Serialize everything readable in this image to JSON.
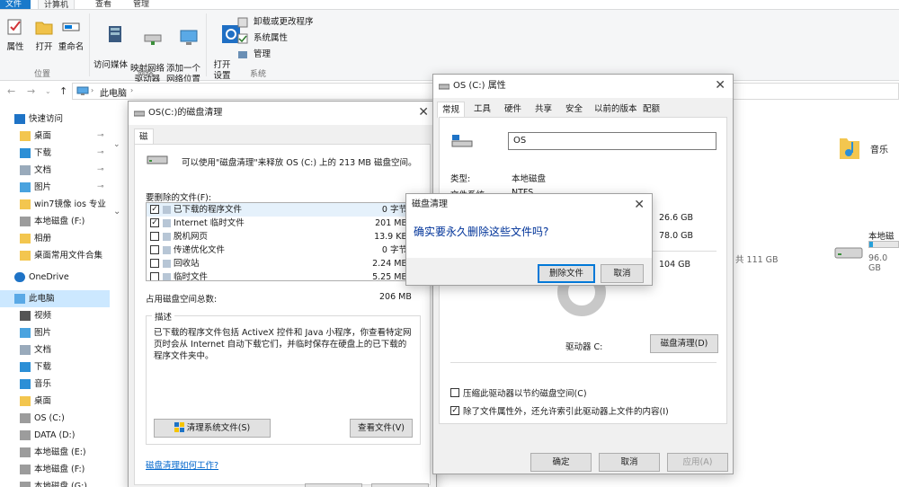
{
  "ribbon": {
    "tabs": [
      "文件",
      "计算机",
      "查看",
      "管理"
    ],
    "location_group": {
      "label": "位置",
      "buttons": [
        "属性",
        "打开",
        "重命名"
      ]
    },
    "network_group": {
      "label": "网络",
      "buttons": [
        "访问媒体",
        "映射网络\n驱动器",
        "添加一个\n网络位置"
      ]
    },
    "system_group": {
      "label": "系统",
      "open_settings": "打开\n设置",
      "small": [
        "卸载或更改程序",
        "系统属性",
        "管理"
      ]
    }
  },
  "address": {
    "path": "此电脑"
  },
  "nav": {
    "items": [
      {
        "label": "快速访问",
        "icon": "star-icon",
        "pinned": false
      },
      {
        "label": "桌面",
        "icon": "folder-icon",
        "pinned": true
      },
      {
        "label": "下载",
        "icon": "download-icon",
        "pinned": true
      },
      {
        "label": "文档",
        "icon": "document-icon",
        "pinned": true
      },
      {
        "label": "图片",
        "icon": "picture-icon",
        "pinned": true
      },
      {
        "label": "win7镜像 ios  专业",
        "icon": "folder-icon",
        "pinned": false
      },
      {
        "label": "本地磁盘 (F:)",
        "icon": "drive-icon",
        "pinned": false
      },
      {
        "label": "相册",
        "icon": "folder-icon",
        "pinned": false
      },
      {
        "label": "桌面常用文件合集",
        "icon": "folder-icon",
        "pinned": false
      },
      {
        "label": "OneDrive",
        "icon": "cloud-icon",
        "pinned": false
      },
      {
        "label": "此电脑",
        "icon": "computer-icon",
        "pinned": false
      },
      {
        "label": "视频",
        "icon": "video-icon",
        "pinned": false
      },
      {
        "label": "图片",
        "icon": "picture-icon",
        "pinned": false
      },
      {
        "label": "文档",
        "icon": "document-icon",
        "pinned": false
      },
      {
        "label": "下载",
        "icon": "download-icon",
        "pinned": false
      },
      {
        "label": "音乐",
        "icon": "music-icon",
        "pinned": false
      },
      {
        "label": "桌面",
        "icon": "folder-icon",
        "pinned": false
      },
      {
        "label": "OS (C:)",
        "icon": "drive-icon",
        "pinned": false
      },
      {
        "label": "DATA (D:)",
        "icon": "drive-icon",
        "pinned": false
      },
      {
        "label": "本地磁盘 (E:)",
        "icon": "drive-icon",
        "pinned": false
      },
      {
        "label": "本地磁盘 (F:)",
        "icon": "drive-icon",
        "pinned": false
      },
      {
        "label": "本地磁盘 (G:)",
        "icon": "drive-icon",
        "pinned": false
      }
    ],
    "selected": "此电脑"
  },
  "content": {
    "music_label": "音乐",
    "drive_free_text": "共 111 GB",
    "drive2_name": "本地磁",
    "drive2_free": "96.0 GB"
  },
  "cleanup": {
    "title": "OS(C:)的磁盘清理",
    "tab": "磁盘清理",
    "intro": "可以使用\"磁盘清理\"来释放 OS (C:) 上的 213 MB 磁盘空间。",
    "files_label": "要删除的文件(F):",
    "files": [
      {
        "name": "已下载的程序文件",
        "size": "0 字节",
        "checked": true
      },
      {
        "name": "Internet 临时文件",
        "size": "201 MB",
        "checked": true
      },
      {
        "name": "脱机网页",
        "size": "13.9 KB",
        "checked": false
      },
      {
        "name": "传递优化文件",
        "size": "0 字节",
        "checked": false
      },
      {
        "name": "回收站",
        "size": "2.24 MB",
        "checked": false
      },
      {
        "name": "临时文件",
        "size": "5.25 MB",
        "checked": false
      }
    ],
    "total_label": "占用磁盘空间总数:",
    "total_value": "206 MB",
    "desc_label": "描述",
    "desc_text": "已下载的程序文件包括 ActiveX 控件和 Java 小程序，你查看特定网页时会从 Internet 自动下载它们，并临时保存在硬盘上的已下载的程序文件夹中。",
    "clean_system_btn": "清理系统文件(S)",
    "view_files_btn": "查看文件(V)",
    "how_link": "磁盘清理如何工作?"
  },
  "props": {
    "title": "OS (C:) 属性",
    "tabs": [
      "常规",
      "工具",
      "硬件",
      "共享",
      "安全",
      "以前的版本",
      "配额"
    ],
    "name_value": "OS",
    "type_label": "类型:",
    "type_value": "本地磁盘",
    "fs_label": "文件系统:",
    "fs_value": "NTFS",
    "used_value": "26.6 GB",
    "free_value": "78.0 GB",
    "capacity_value": "104 GB",
    "drive_label": "驱动器 C:",
    "cleanup_btn": "磁盘清理(D)",
    "compress_label": "压缩此驱动器以节约磁盘空间(C)",
    "compress_checked": false,
    "index_label": "除了文件属性外，还允许索引此驱动器上文件的内容(I)",
    "index_checked": true,
    "ok": "确定",
    "cancel": "取消",
    "apply": "应用(A)"
  },
  "confirm": {
    "title": "磁盘清理",
    "message": "确实要永久删除这些文件吗?",
    "delete_btn": "删除文件",
    "cancel_btn": "取消"
  },
  "colors": {
    "accent": "#0078d7",
    "selection": "#cce8ff",
    "message_blue": "#003399"
  }
}
